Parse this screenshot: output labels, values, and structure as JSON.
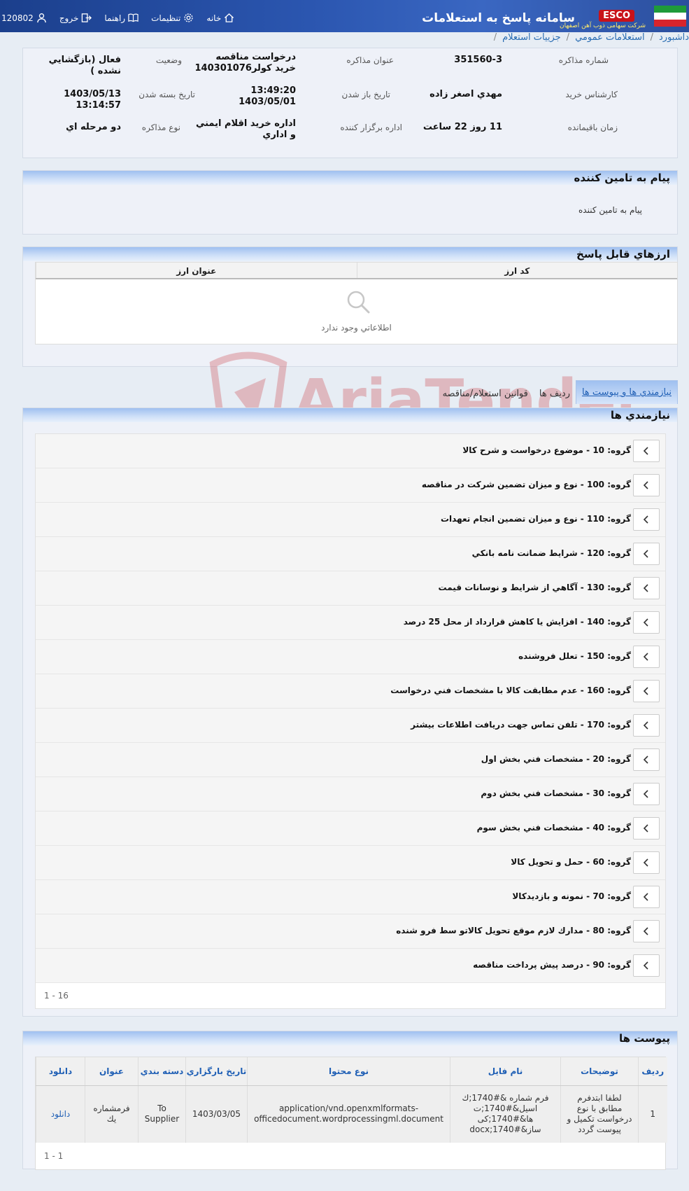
{
  "header": {
    "app_title": "سامانه پاسخ به استعلامات",
    "brand": "ESCO",
    "brand_sub": "شرکت سهامی ذوب آهن اصفهان",
    "nav": {
      "home": "خانه",
      "settings": "تنظيمات",
      "help": "راهنما",
      "logout": "خروج",
      "user_id": "120802"
    }
  },
  "breadcrumb": [
    "داشبورد",
    "استعلامات عمومي",
    "جزييات استعلام"
  ],
  "info": {
    "number_label": "شماره مذاكره",
    "number_value": "351560-3",
    "title_label": "عنوان مذاكره",
    "title_value_1": "درخواست مناقصه",
    "title_value_2": "خريد كولر140301076",
    "status_label": "وضعيت",
    "status_value": "فعال (بازگشايي نشده )",
    "expert_label": "كارشناس خريد",
    "expert_value": "مهدي اصغر زاده",
    "open_date_label": "تاريخ باز شدن",
    "open_time": "13:49:20",
    "open_date": "1403/05/01",
    "close_date_label": "تاريخ بسته شدن",
    "close_value": "1403/05/13 13:14:57",
    "remaining_label": "زمان باقيمانده",
    "remaining_value": "11 روز 22 ساعت",
    "office_label": "اداره برگزار كننده",
    "office_value_1": "اداره خريد اقلام ايمني",
    "office_value_2": "و اداري",
    "type_label": "نوع مذاكره",
    "type_value": "دو مرحله اي"
  },
  "supplier": {
    "heading": "پيام به تامين كننده",
    "text": "پيام به تامين كننده"
  },
  "currency": {
    "heading": "ارزهاي قابل پاسخ",
    "col_code": "كد ارز",
    "col_title": "عنوان ارز",
    "empty": "اطلاعاتي وجود ندارد"
  },
  "tabs": [
    "نيازمندي ها و پيوست ها",
    "رديف ها",
    "قوانين استعلام/مناقصه"
  ],
  "needs": {
    "heading": "نيازمندي ها",
    "groups": [
      "گروه: 10 - موضوع درخواست و شرح كالا",
      "گروه: 100 - نوع و ميزان تضمين شركت در مناقصه",
      "گروه: 110 - نوع و ميزان تضمين انجام تعهدات",
      "گروه: 120 - شرايط ضمانت نامه بانكي",
      "گروه: 130 - آگاهي از شرايط و نوسانات قيمت",
      "گروه: 140 - افزايش يا كاهش قرارداد از محل 25 درصد",
      "گروه: 150 - تعلل فروشنده",
      "گروه: 160 - عدم مطابقت كالا با مشخصات فني درخواست",
      "گروه: 170 - تلفن تماس جهت دريافت اطلاعات بيشتر",
      "گروه: 20 - مشخصات فني بخش اول",
      "گروه: 30 - مشخصات فني بخش دوم",
      "گروه: 40 - مشخصات فني بخش سوم",
      "گروه: 60 - حمل و تحويل كالا",
      "گروه: 70 - نمونه و بازديدكالا",
      "گروه: 80 - مدارك لازم موقع تحويل كالاتو سط فرو شنده",
      "گروه: 90 - درصد پيش پرداخت مناقصه"
    ],
    "pager": "1 - 16"
  },
  "attachments": {
    "heading": "پيوست ها",
    "columns": [
      "رديف",
      "توضيحات",
      "نام فايل",
      "نوع محتوا",
      "تاريخ بارگزاري",
      "دسته بندي",
      "عنوان",
      "دانلود"
    ],
    "rows": [
      {
        "row": "1",
        "desc": "لطفا ابتدفرم مطابق با نوع درخواست تكميل و پيوست گردد",
        "file": "فرم شماره &#1740;ك اسيل&#1740;ت ها&#1740;كى ساز&#1740;docx",
        "mime": "application/vnd.openxmlformats-officedocument.wordprocessingml.document",
        "date": "1403/03/05",
        "category": "To Supplier",
        "title": "فرمشماره يك",
        "download": "دانلود"
      }
    ],
    "pager": "1 - 1"
  },
  "watermark": "AriaTender.neT",
  "colors": {
    "header_bg": "#2b56b0",
    "section_head": "#9fc0f0",
    "link": "#1f5fb5",
    "watermark": "#c8323a"
  }
}
